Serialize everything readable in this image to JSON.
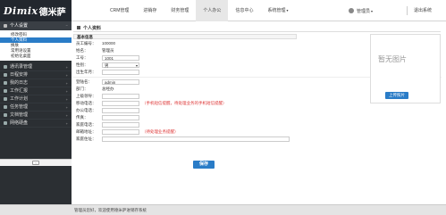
{
  "logo": {
    "main": "Dimix",
    "cn": "德米萨"
  },
  "topnav": [
    {
      "label": "CRM管理"
    },
    {
      "label": "进销存"
    },
    {
      "label": "财务管理"
    },
    {
      "label": "个人办公"
    },
    {
      "label": "信息中心"
    },
    {
      "label": "系统管理"
    }
  ],
  "topnav_caret": "▾",
  "user": {
    "name": "管理员",
    "caret": "▾",
    "logout": "退出系统"
  },
  "sidebar": {
    "group_title": "个人设置",
    "group_caret": "−",
    "sub_items": [
      "修改密码",
      "个人资料",
      "换肤",
      "常用语设置",
      "初始化桌面"
    ],
    "active_index": 1,
    "menu": [
      "通讯录管理",
      "日程安排",
      "我的日志",
      "工作汇报",
      "工作计划",
      "任务管理",
      "文档管理",
      "网络硬盘"
    ],
    "menu_caret": "+",
    "collapse": "‹"
  },
  "panel": {
    "title": "个人资料",
    "section": "基本信息"
  },
  "form": {
    "staff_no_label": "员工编号：",
    "staff_no": "100000",
    "name_label": "姓名：",
    "name": "管理员",
    "job_no_label": "工号：",
    "job_no": "1001",
    "gender_label": "性别：",
    "gender": "男",
    "birth_label": "出生年月：",
    "birth": "",
    "login_label": "登陆名：",
    "login": "admin",
    "dept_label": "部门：",
    "dept": "总经办",
    "superior_label": "上级领导：",
    "superior": "",
    "mobile_label": "移动电话：",
    "mobile": "",
    "mobile_hint": "（手机短信提醒，待处理业务的手机短信提醒）",
    "office_phone_label": "办公电话：",
    "office_phone": "",
    "fax_label": "传真：",
    "fax": "",
    "home_phone_label": "家庭电话：",
    "home_phone": "",
    "email_label": "邮箱地址：",
    "email": "",
    "email_hint": "（待处理业务提醒）",
    "home_addr_label": "家庭住址：",
    "home_addr": ""
  },
  "select_caret": "▾",
  "photo": {
    "placeholder": "暂无图片",
    "upload": "上传照片"
  },
  "save": "保存",
  "footer": "管理员您好，欢迎使用德米萨进销存系统"
}
